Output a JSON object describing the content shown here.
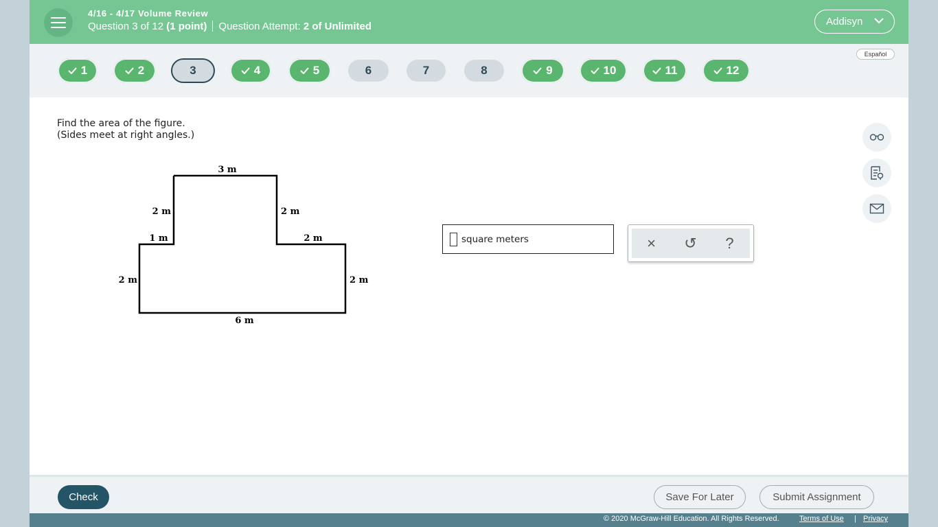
{
  "header": {
    "title": "4/16 - 4/17 Volume Review",
    "question_label": "Question 3 of 12",
    "points": "(1 point)",
    "attempt_label": "Question Attempt:",
    "attempt_value": "2 of Unlimited",
    "user_name": "Addisyn"
  },
  "nav": {
    "language": "Español",
    "questions": [
      {
        "label": "1",
        "status": "done"
      },
      {
        "label": "2",
        "status": "done"
      },
      {
        "label": "3",
        "status": "current"
      },
      {
        "label": "4",
        "status": "done"
      },
      {
        "label": "5",
        "status": "done"
      },
      {
        "label": "6",
        "status": "open"
      },
      {
        "label": "7",
        "status": "open"
      },
      {
        "label": "8",
        "status": "open"
      },
      {
        "label": "9",
        "status": "done"
      },
      {
        "label": "10",
        "status": "done"
      },
      {
        "label": "11",
        "status": "done"
      },
      {
        "label": "12",
        "status": "done"
      }
    ]
  },
  "question": {
    "line1": "Find the area of the figure.",
    "line2": "(Sides meet at right angles.)",
    "figure_labels": {
      "top": "3 m",
      "upper_left": "2 m",
      "upper_right": "2 m",
      "ledge_left": "1 m",
      "ledge_right": "2 m",
      "lower_left": "2 m",
      "lower_right": "2 m",
      "bottom": "6 m"
    },
    "answer_value": "",
    "answer_unit": "square meters"
  },
  "tools": {
    "clear_symbol": "×",
    "undo_symbol": "↺",
    "help_symbol": "?"
  },
  "side_tools": [
    "glasses-icon",
    "notes-icon",
    "mail-icon"
  ],
  "footer": {
    "check_label": "Check",
    "save_label": "Save For Later",
    "submit_label": "Submit Assignment",
    "copyright": "© 2020 McGraw-Hill Education. All Rights Reserved.",
    "terms_label": "Terms of Use",
    "divider": "|",
    "privacy_label": "Privacy"
  },
  "colors": {
    "header_green": "#76c694",
    "done_green": "#5ab66e",
    "dark_teal": "#245566",
    "bottom_bar": "#56808e"
  }
}
